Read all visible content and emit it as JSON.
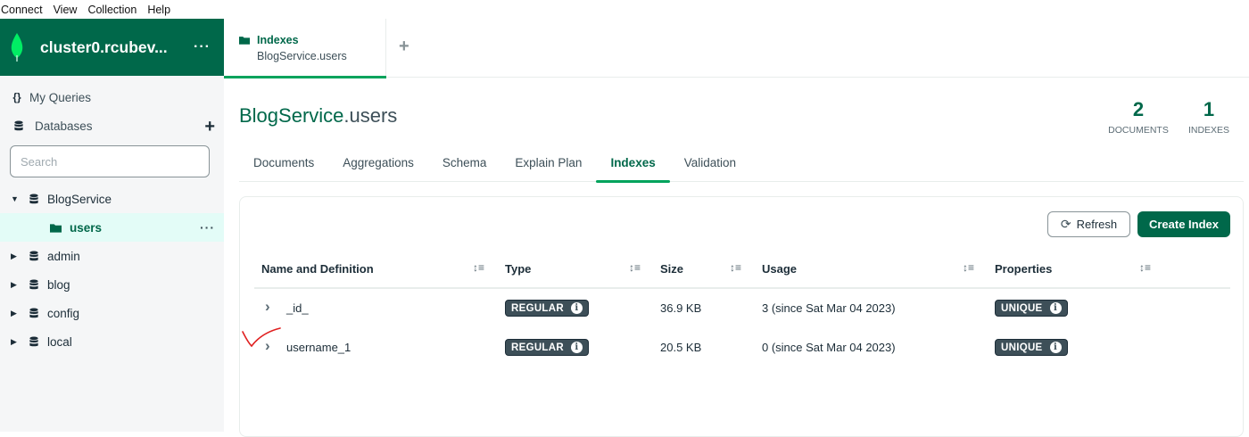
{
  "menu": [
    "Connect",
    "View",
    "Collection",
    "Help"
  ],
  "sidebar": {
    "connection_name": "cluster0.rcubev...",
    "my_queries": "My Queries",
    "databases": "Databases",
    "search_placeholder": "Search",
    "tree": [
      {
        "name": "BlogService",
        "expanded": true
      },
      {
        "name": "users",
        "selected": true
      },
      {
        "name": "admin"
      },
      {
        "name": "blog"
      },
      {
        "name": "config"
      },
      {
        "name": "local"
      }
    ]
  },
  "tab": {
    "title": "Indexes",
    "subtitle": "BlogService.users"
  },
  "header": {
    "db": "BlogService",
    "coll": ".users",
    "documents_count": "2",
    "documents_label": "DOCUMENTS",
    "indexes_count": "1",
    "indexes_label": "INDEXES"
  },
  "subtabs": [
    "Documents",
    "Aggregations",
    "Schema",
    "Explain Plan",
    "Indexes",
    "Validation"
  ],
  "buttons": {
    "refresh": "Refresh",
    "create_index": "Create Index"
  },
  "columns": [
    "Name and Definition",
    "Type",
    "Size",
    "Usage",
    "Properties"
  ],
  "rows": [
    {
      "name": "_id_",
      "type": "REGULAR",
      "size": "36.9 KB",
      "usage": "3 (since Sat Mar 04 2023)",
      "property": "UNIQUE"
    },
    {
      "name": "username_1",
      "type": "REGULAR",
      "size": "20.5 KB",
      "usage": "0 (since Sat Mar 04 2023)",
      "property": "UNIQUE"
    }
  ],
  "colors": {
    "brand": "#00684a",
    "accent": "#00a35c",
    "badge": "#3d4f58"
  }
}
